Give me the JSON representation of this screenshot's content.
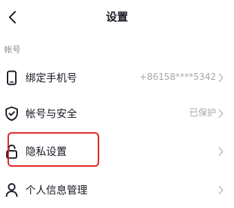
{
  "header": {
    "title": "设置",
    "back_icon": "chevron-left-icon"
  },
  "section": {
    "title": "帐号"
  },
  "rows": [
    {
      "label": "绑定手机号",
      "value": "+86158****5342",
      "icon": "phone-icon"
    },
    {
      "label": "帐号与安全",
      "value": "已保护",
      "icon": "shield-check-icon"
    },
    {
      "label": "隐私设置",
      "value": "",
      "icon": "lock-icon"
    },
    {
      "label": "个人信息管理",
      "value": "",
      "icon": "person-icon"
    }
  ],
  "colors": {
    "highlight": "#e01e1e",
    "text_primary": "#161823",
    "text_secondary": "#a6a7ad"
  }
}
